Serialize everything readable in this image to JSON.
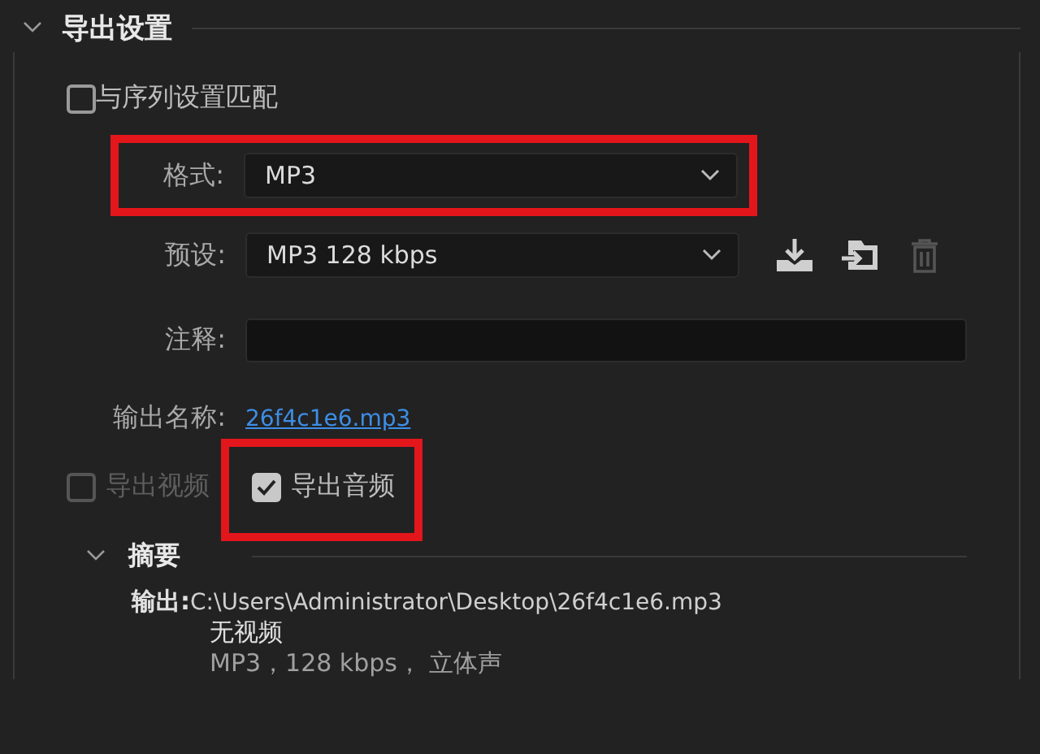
{
  "section": {
    "title": "导出设置",
    "expanded": true
  },
  "match_sequence": {
    "label": "与序列设置匹配",
    "checked": false
  },
  "format": {
    "label": "格式:",
    "value": "MP3",
    "highlighted": true
  },
  "preset": {
    "label": "预设:",
    "value": "MP3 128 kbps"
  },
  "comment": {
    "label": "注释:"
  },
  "output_name": {
    "label": "输出名称:",
    "value": "26f4c1e6.mp3"
  },
  "export_options": [
    {
      "label": "导出视频",
      "checked": false,
      "disabled": true,
      "highlighted": false
    },
    {
      "label": "导出音频",
      "checked": true,
      "disabled": false,
      "highlighted": true
    }
  ],
  "summary": {
    "title": "摘要",
    "expanded": true,
    "output_label": "输出:",
    "path": "C:\\Users\\Administrator\\Desktop\\26f4c1e6.mp3",
    "video": "无视频",
    "audio": "MP3，128 kbps， 立体声"
  }
}
